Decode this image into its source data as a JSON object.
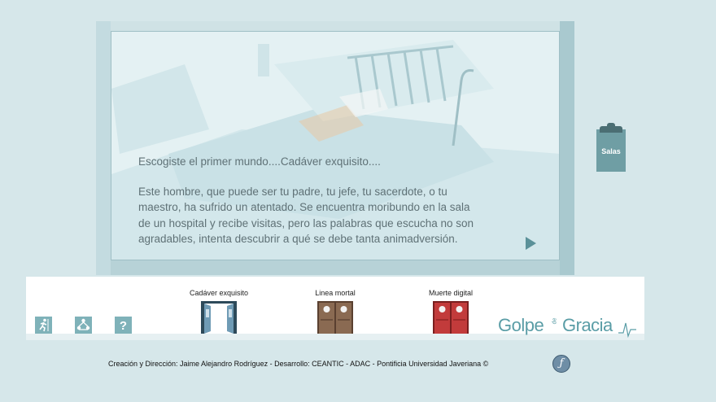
{
  "story": {
    "intro": "Escogiste el primer mundo....Cadáver exquisito....",
    "body_lines": [
      "Este hombre, que puede ser tu padre, tu jefe, tu sacerdote, o tu",
      "maestro, ha sufrido un atentado. Se encuentra moribundo en la sala",
      "de un hospital y recibe visitas, pero las palabras que escucha no son",
      "agradables, intenta descubrir a qué se debe tanta animadversión."
    ]
  },
  "clipboard": {
    "label": "Salas"
  },
  "toolbar_icons": [
    "exit-icon",
    "map-icon",
    "help-icon"
  ],
  "help_glyph": "?",
  "doors": [
    {
      "label": "Cadáver exquisito",
      "state": "open",
      "color": "#6f9bb5"
    },
    {
      "label": "Linea mortal",
      "state": "closed",
      "color": "#8a6a52"
    },
    {
      "label": "Muerte digital",
      "state": "closed",
      "color": "#c23b3b"
    }
  ],
  "logo": {
    "left": "Golpe",
    "middle": "de",
    "right": "Gracia"
  },
  "credits": "Creación y Dirección: Jaime Alejandro Rodríguez - Desarrollo: CEANTIC - ADAC - Pontificia Universidad Javeriana ©",
  "colors": {
    "background": "#d6e7ea",
    "frame": "#b7d2d7",
    "teal": "#5a9da6"
  }
}
